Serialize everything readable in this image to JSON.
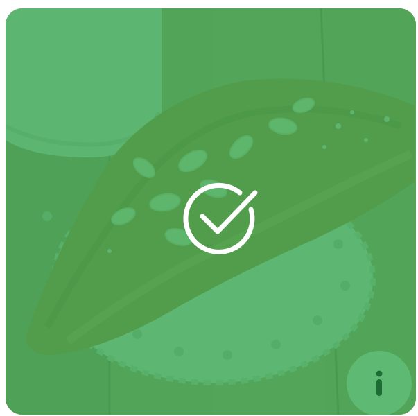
{
  "card": {
    "image_subject": "almond-croissant-photo",
    "selected": true,
    "overlay_color": "#34A853",
    "check_icon": "check-circle-icon",
    "info_icon": "info-icon"
  },
  "colors": {
    "overlay": "#34A853",
    "icon_fg": "#FFFFFF",
    "info_button_bg": "#5FBE78",
    "info_glyph": "#1E6B36"
  }
}
